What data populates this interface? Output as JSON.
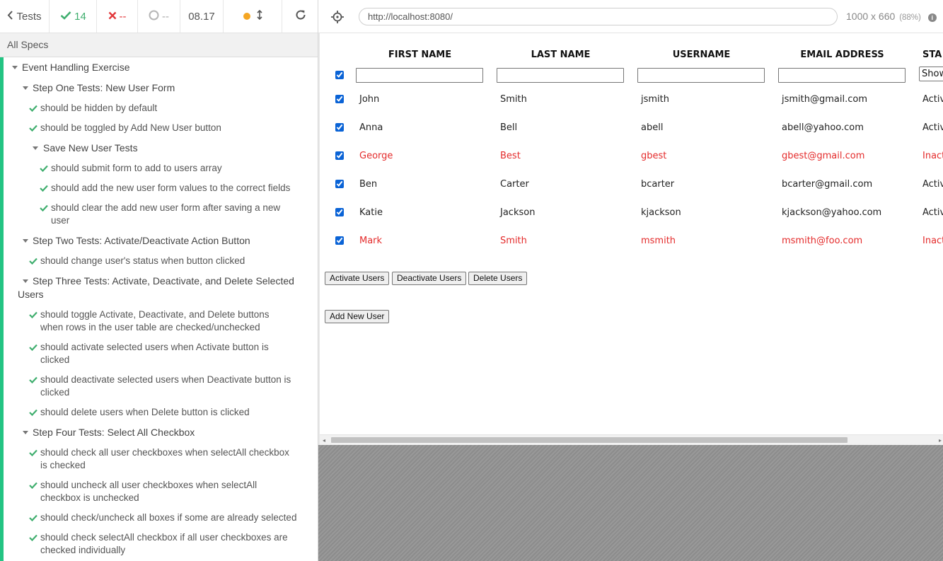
{
  "reporter": {
    "header": {
      "tests_label": "Tests",
      "passed": "14",
      "failed": "--",
      "pending": "--",
      "duration": "08.17"
    },
    "all_specs": "All Specs",
    "root_suite": "Event Handling Exercise",
    "step_one": {
      "title": "Step One Tests: New User Form",
      "tests": [
        "should be hidden by default",
        "should be toggled by Add New User button"
      ],
      "save_suite": {
        "title": "Save New User Tests",
        "tests": [
          "should submit form to add to users array",
          "should add the new user form values to the correct fields",
          [
            "should clear the add new user form after saving a new",
            "user"
          ]
        ]
      }
    },
    "step_two": {
      "title": "Step Two Tests: Activate/Deactivate Action Button",
      "tests": [
        "should change user's status when button clicked"
      ]
    },
    "step_three": {
      "title": [
        "Step Three Tests: Activate, Deactivate, and Delete Selected",
        "Users"
      ],
      "tests": [
        [
          "should toggle Activate, Deactivate, and Delete buttons",
          "when rows in the user table are checked/unchecked"
        ],
        [
          "should activate selected users when Activate button is",
          "clicked"
        ],
        [
          "should deactivate selected users when Deactivate button is",
          "clicked"
        ],
        "should delete users when Delete button is clicked"
      ]
    },
    "step_four": {
      "title": "Step Four Tests: Select All Checkbox",
      "tests": [
        [
          "should check all user checkboxes when selectAll checkbox",
          "is checked"
        ],
        [
          "should uncheck all user checkboxes when selectAll",
          "checkbox is unchecked"
        ],
        "should check/uncheck all boxes if some are already selected",
        [
          "should check selectAll checkbox if all user checkboxes are",
          "checked individually"
        ]
      ]
    }
  },
  "aut": {
    "url": "http://localhost:8080/",
    "viewport": "1000 x 660",
    "scale": "(88%)",
    "table": {
      "headers": [
        "FIRST NAME",
        "LAST NAME",
        "USERNAME",
        "EMAIL ADDRESS",
        "STA"
      ],
      "status_filter": "Show",
      "rows": [
        {
          "first": "John",
          "last": "Smith",
          "username": "jsmith",
          "email": "jsmith@gmail.com",
          "status": "Active",
          "active": true
        },
        {
          "first": "Anna",
          "last": "Bell",
          "username": "abell",
          "email": "abell@yahoo.com",
          "status": "Active",
          "active": true
        },
        {
          "first": "George",
          "last": "Best",
          "username": "gbest",
          "email": "gbest@gmail.com",
          "status": "Inactive",
          "active": false
        },
        {
          "first": "Ben",
          "last": "Carter",
          "username": "bcarter",
          "email": "bcarter@gmail.com",
          "status": "Active",
          "active": true
        },
        {
          "first": "Katie",
          "last": "Jackson",
          "username": "kjackson",
          "email": "kjackson@yahoo.com",
          "status": "Active",
          "active": true
        },
        {
          "first": "Mark",
          "last": "Smith",
          "username": "msmith",
          "email": "msmith@foo.com",
          "status": "Inactive",
          "active": false
        }
      ]
    },
    "buttons": {
      "activate": "Activate Users",
      "deactivate": "Deactivate Users",
      "delete": "Delete Users",
      "add_new": "Add New User"
    }
  },
  "colors": {
    "pass": "#3fae6e",
    "fail": "#e2373a",
    "inactive_text": "#e42b2b",
    "pass_bar": "#23c483"
  }
}
